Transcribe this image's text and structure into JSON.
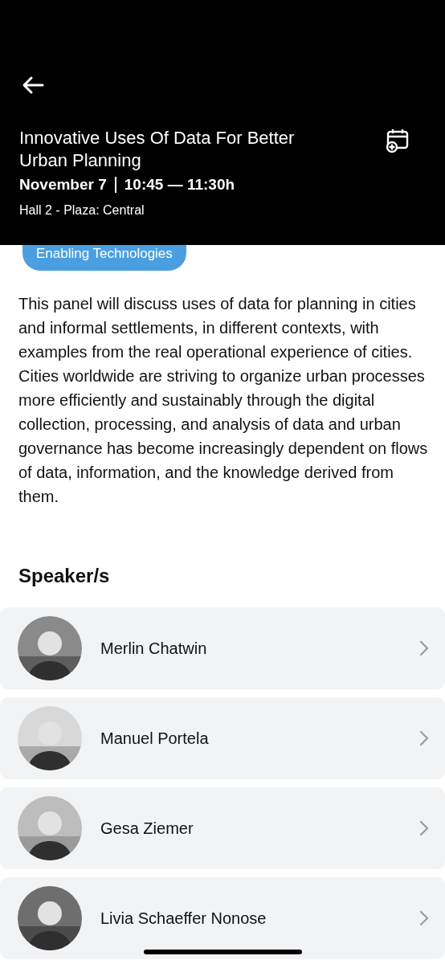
{
  "header": {
    "title": "Innovative Uses Of Data For Better Urban Planning",
    "date": "November 7",
    "time": "10:45 — 11:30h",
    "location": "Hall 2 - Plaza: Central"
  },
  "tag": "Enabling Technologies",
  "description": "This panel will discuss uses of data for planning in cities and informal settlements, in different contexts, with examples from the real operational experience of cities. Cities worldwide are striving to organize urban processes more efficiently and sustainably through the digital collection, processing, and analysis of data and urban governance has become increasingly dependent on flows of data, information, and the knowledge derived from them.",
  "speakers_heading": "Speaker/s",
  "speakers": [
    {
      "name": "Merlin Chatwin"
    },
    {
      "name": "Manuel Portela"
    },
    {
      "name": "Gesa Ziemer"
    },
    {
      "name": "Livia Schaeffer Nonose"
    }
  ]
}
